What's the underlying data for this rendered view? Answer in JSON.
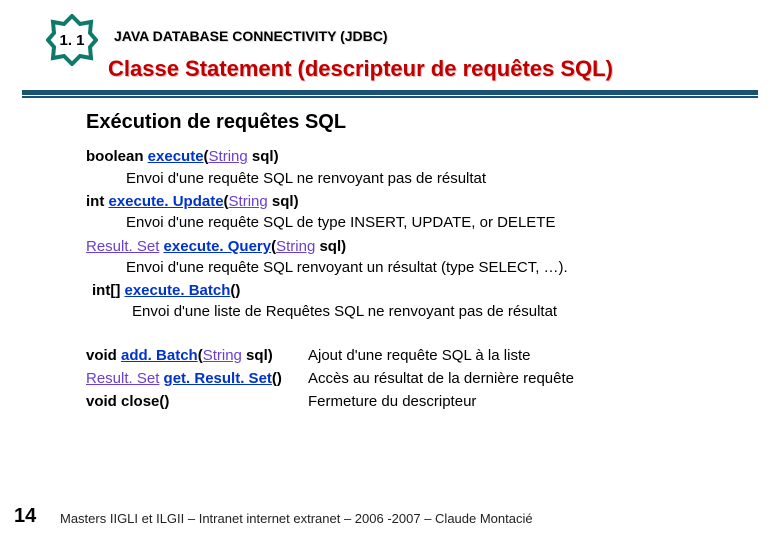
{
  "badge": {
    "number": "1. 1"
  },
  "chapter": "JAVA DATABASE CONNECTIVITY (JDBC)",
  "title": "Classe Statement (descripteur de requêtes SQL)",
  "heading": "Exécution de requêtes SQL",
  "methods": [
    {
      "ret": "boolean ",
      "name": "execute",
      "open": "(",
      "ptype": "String",
      "pname": " sql",
      "close": ")",
      "desc": "Envoi d'une requête SQL ne renvoyant pas de résultat"
    },
    {
      "ret": "int ",
      "name": "execute. Update",
      "open": "(",
      "ptype": "String",
      "pname": " sql",
      "close": ")",
      "desc": "Envoi d'une requête SQL de type INSERT, UPDATE, or DELETE"
    },
    {
      "ret_link": "Result. Set",
      "ret_after": " ",
      "name": "execute. Query",
      "open": "(",
      "ptype": "String",
      "pname": " sql",
      "close": ")",
      "desc": "Envoi d'une requête SQL renvoyant un résultat (type SELECT, …)."
    },
    {
      "indent": " ",
      "ret": "int[] ",
      "name": "execute. Batch",
      "open": "(",
      "ptype": "",
      "pname": "",
      "close": ")",
      "desc": "Envoi d'une liste de Requêtes SQL ne renvoyant pas de résultat",
      "desc_indent": true
    }
  ],
  "extra_left": [
    {
      "ret": "void ",
      "name": "add. Batch",
      "open": "(",
      "ptype": "String",
      "pname": " sql",
      "close": ")"
    },
    {
      "ret_link": "Result. Set",
      "ret_after": " ",
      "name": "get. Result. Set",
      "open": "(",
      "ptype": "",
      "pname": "",
      "close": ")"
    },
    {
      "ret": "void ",
      "plain_name": "close",
      "open": "(",
      "ptype": "",
      "pname": "",
      "close": ")"
    }
  ],
  "extra_right": [
    "Ajout d'une requête SQL à la liste",
    "Accès au résultat de la dernière requête",
    "Fermeture du descripteur"
  ],
  "footer": "Masters IIGLI et ILGII – Intranet internet extranet – 2006 -2007 – Claude Montacié",
  "pagenum": "14"
}
